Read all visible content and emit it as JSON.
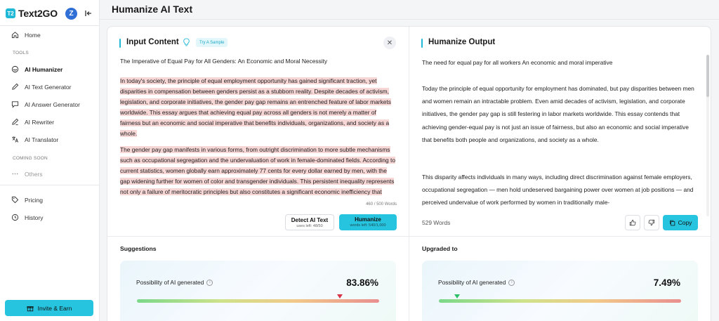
{
  "brand": {
    "logo_text": "T2",
    "name": "Text2GO"
  },
  "user": {
    "avatar_letter": "Z"
  },
  "sidebar": {
    "home": "Home",
    "tools_heading": "TOOLS",
    "tools": [
      "AI Humanizer",
      "AI Text Generator",
      "AI Answer Generator",
      "AI Rewriter",
      "AI Translator"
    ],
    "coming_soon_heading": "COMING SOON",
    "others": "Others",
    "pricing": "Pricing",
    "history": "History",
    "invite": "Invite & Earn"
  },
  "page_title": "Humanize AI Text",
  "input": {
    "title": "Input Content",
    "try_sample": "Try A Sample",
    "clear": "✕",
    "heading": "The Imperative of Equal Pay for All Genders: An Economic and Moral Necessity",
    "paragraphs": [
      "In today's society, the principle of equal employment opportunity has gained significant traction, yet disparities in compensation between genders persist as a stubborn reality. Despite decades of activism, legislation, and corporate initiatives, the gender pay gap remains an entrenched feature of labor markets worldwide. This essay argues that achieving equal pay across all genders is not merely a matter of fairness but an economic and social imperative that benefits individuals, organizations, and society as a whole.",
      "The gender pay gap manifests in various forms, from outright discrimination to more subtle mechanisms such as occupational segregation and the undervaluation of work in female-dominated fields. According to current statistics, women globally earn approximately 77 cents for every dollar earned by men, with the gap widening further for women of color and transgender individuals. This persistent inequality represents not only a failure of meritocratic principles but also constitutes a significant economic inefficiency that undermines productivity and innovation"
    ],
    "word_count": "460 / 500 Words",
    "detect_label": "Detect AI Text",
    "detect_sub": "uses left: 48/50",
    "humanize_label": "Humanize",
    "humanize_sub": "words left: 540/1,000"
  },
  "output": {
    "title": "Humanize Output",
    "heading": "The need for equal pay for all workers An economic and moral imperative",
    "paragraphs": [
      "Today the principle of equal opportunity for employment has dominated, but pay disparities between men and women remain an intractable problem. Even amid decades of activism, legislation, and corporate initiatives, the gender pay gap is still festering in labor markets worldwide. This essay contends that achieving gender-equal pay is not just an issue of fairness, but also an economic and social imperative that benefits both people and organizations, and society as a whole.",
      "This disparity affects individuals in many ways, including direct discrimination against female employers, occupational segregation — men hold undeserved bargaining power over women at job positions — and perceived undervalue of work performed by women in traditionally male-"
    ],
    "word_count": "529 Words",
    "copy_label": "Copy"
  },
  "suggestions": {
    "title": "Suggestions",
    "label": "Possibility of AI generated",
    "score": "83.86%",
    "score_fraction": 0.8386
  },
  "upgraded": {
    "title": "Upgraded to",
    "label": "Possibility of AI generated",
    "score": "7.49%",
    "score_fraction": 0.0749
  },
  "colors": {
    "accent": "#27c4df",
    "highlight": "#f7d6d6",
    "marker_bad": "#d8334a",
    "marker_good": "#2bbf6a"
  }
}
